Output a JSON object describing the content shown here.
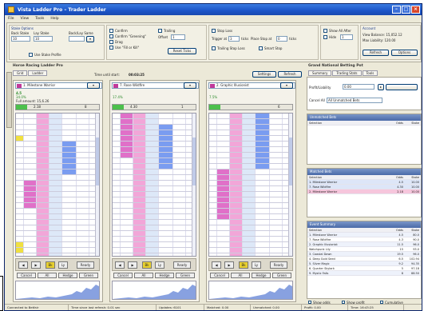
{
  "window": {
    "title": "Vista Ladder Pro – Trader Ladder"
  },
  "menu": [
    "File",
    "View",
    "Tools",
    "Help"
  ],
  "toolbar": {
    "group1": {
      "title": "Stake Options",
      "stake_label": "Back Stake",
      "lay_label": "Lay Stake",
      "stake_value": "10",
      "lay_value": "10",
      "extra_label": "Back/Lay Same",
      "check_label": "Use Stake Profile"
    },
    "group2": {
      "opt1": "Confirm",
      "opt2": "Confirm \"Greening\"",
      "opt3": "Drag",
      "opt4": "Use \"Fill or Kill\"",
      "opt5": "Trailing",
      "opt6": "Offset",
      "select_value": "1",
      "button": "Reset Ticks"
    },
    "group3": {
      "opt1": "Stop Loss",
      "trigger_label": "Trigger at",
      "ticks_label": "ticks",
      "place_label": "Place Stop at",
      "ticks2_label": "ticks",
      "trigger_value": "3",
      "place_value": "0",
      "opt2": "Trailing Stop Loss",
      "opt3": "Smart Stop"
    },
    "group4": {
      "opt1": "Show All After",
      "opt2": "Hide",
      "value": "1"
    },
    "account": {
      "title": "Account",
      "line1": "View Balance: 15,052.12",
      "line2": "Max Liability: 120.00",
      "refresh": "Refresh",
      "options": "Options"
    }
  },
  "main": {
    "title": "Horse Racing Ladder Pro",
    "tabs": [
      "Grid",
      "Ladder"
    ],
    "market_label": "Time until start:",
    "market_time": "00:03:25",
    "settings_btn": "Settings",
    "refresh_btn": "Refresh",
    "side_label": "Market",
    "panels": [
      {
        "runner": "1. Milestone Warrior",
        "odds": "4.5",
        "last": "34.0%",
        "note": "Full amount: 15,6.26",
        "back": "2.18",
        "lay": "8",
        "accent": "#c0399a"
      },
      {
        "runner": "7. Rose Wildfire",
        "odds": "",
        "last": "17.4%",
        "note": "",
        "back": "4.30",
        "lay": "1",
        "accent": "#c0399a"
      },
      {
        "runner": "2. Graphic Illusionist",
        "odds": "",
        "last": "7.5%",
        "note": "",
        "back": "",
        "lay": "6",
        "accent": "#c0399a"
      }
    ],
    "ladder_buttons": [
      "◀",
      "▶",
      "Bk",
      "Ly",
      "Ready"
    ],
    "cancel_labels": [
      "Cancel",
      "All",
      "Hedge",
      "Green"
    ]
  },
  "right": {
    "title": "Grand National Betting Pot",
    "tabs": [
      "Summary",
      "Trading Stats",
      "Tools"
    ],
    "field_label": "Profit/Liability",
    "field_value": "0.00",
    "cancel_label": "Cancel All",
    "cancel_value": "All Unmatched Bets",
    "boxes": [
      {
        "title": "Unmatched Bets",
        "headers": [
          "Selection",
          "Odds",
          "Stake"
        ],
        "rows": []
      },
      {
        "title": "Matched Bets",
        "headers": [
          "Selection",
          "Odds",
          "Stake"
        ],
        "rows": [
          {
            "name": "1. Milestone Warrior",
            "odds": "4.5",
            "stake": "10.00"
          },
          {
            "name": "7. Rose Wildfire",
            "odds": "4.30",
            "stake": "10.00"
          },
          {
            "name": "2. Milestone Warrior",
            "odds": "2.18",
            "stake": "10.00"
          }
        ]
      },
      {
        "title": "Event Summary",
        "headers": [
          "Selection",
          "Odds",
          "Stake"
        ],
        "rows": [
          {
            "name": "1. Milestone Warrior",
            "odds": "4.5",
            "stake": "80.0"
          },
          {
            "name": "7. Rose Wildfire",
            "odds": "4.3",
            "stake": "90.0"
          },
          {
            "name": "2. Graphic Illusionist",
            "odds": "11.5",
            "stake": "96.0"
          },
          {
            "name": "Watchpunk Lily",
            "odds": "15",
            "stake": "93.0"
          },
          {
            "name": "3. Coastal Dawn",
            "odds": "19.5",
            "stake": "96.0"
          },
          {
            "name": "4. Deep Gold Seed",
            "odds": "6.5",
            "stake": "102.94"
          },
          {
            "name": "5. Silver Magic",
            "odds": "9.2",
            "stake": "94.35"
          },
          {
            "name": "6. Quarter Skylark",
            "odds": "5",
            "stake": "97.18"
          },
          {
            "name": "9. Mystic Falls",
            "odds": "8",
            "stake": "88.50"
          }
        ]
      }
    ],
    "footer_checks": [
      "Show odds",
      "Show profit",
      "Cumulative"
    ]
  },
  "statusbar": [
    "Connected to Betfair",
    "Time since last refresh: 0.01 sec",
    "Updates: 6101",
    "Matched: 0.00",
    "Unmatched: 0.00",
    "Profit: 0.00",
    "Time: 16:43:25"
  ],
  "colors": {
    "pink": "#f2a6d8",
    "blue": "#7a9cf0",
    "yellow": "#f0e040",
    "title": "#1c55c8"
  }
}
